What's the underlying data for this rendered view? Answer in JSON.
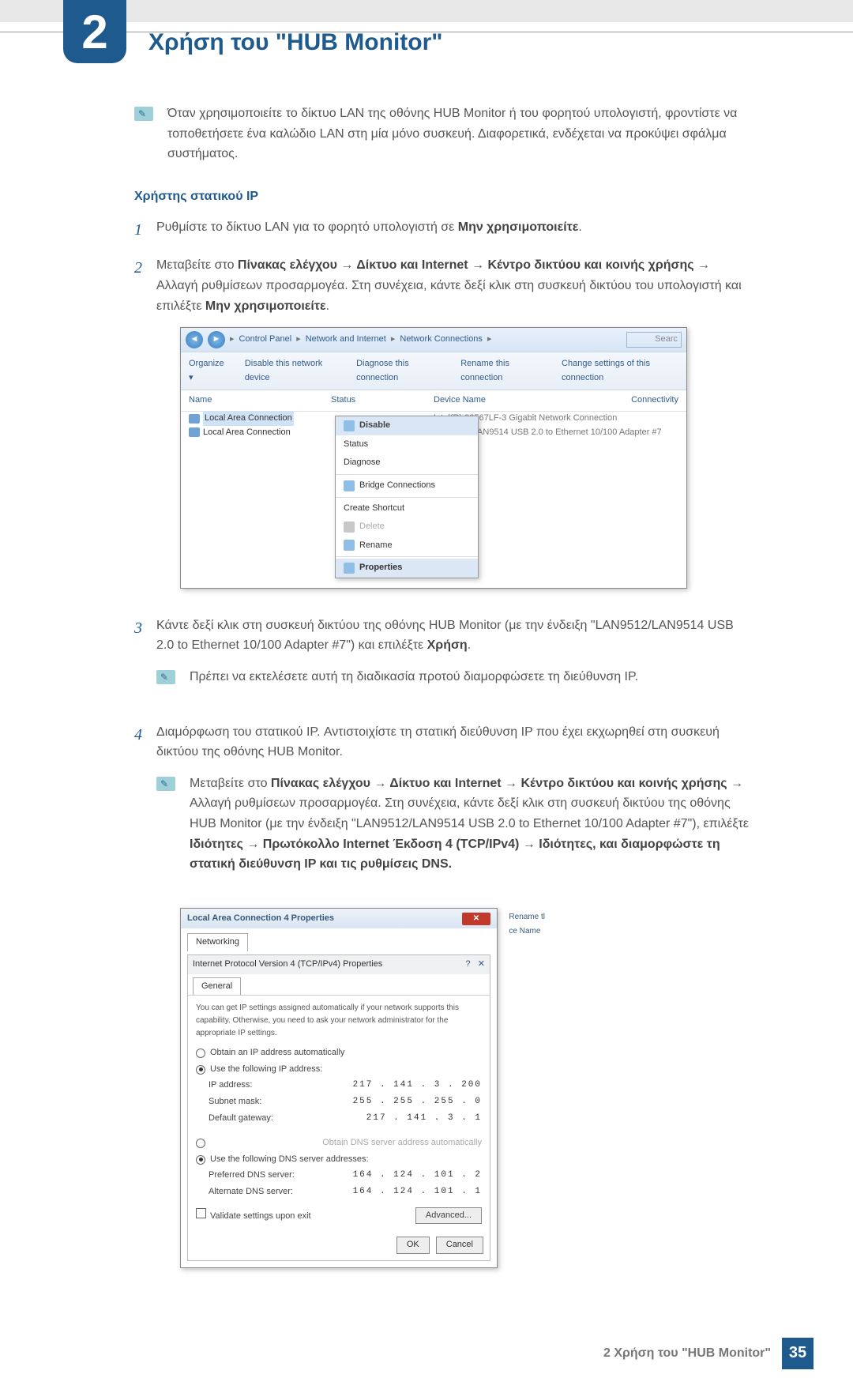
{
  "chapter": {
    "number": "2",
    "title": "Χρήση του \"HUB Monitor\""
  },
  "top_note": "Όταν χρησιμοποιείτε το δίκτυο LAN της οθόνης HUB Monitor ή του φορητού υπολογιστή, φροντίστε να τοποθετήσετε ένα καλώδιο LAN στη μία μόνο συσκευή. Διαφορετικά, ενδέχεται να προκύψει σφάλμα συστήματος.",
  "section_heading": "Χρήστης στατικού IP",
  "steps": {
    "1": {
      "pre": "Ρυθμίστε το δίκτυο LAN για το φορητό υπολογιστή σε ",
      "bold": "Μην χρησιμοποιείτε",
      "post": "."
    },
    "2": {
      "p1a": "Μεταβείτε στο ",
      "p1b": "Πίνακας ελέγχου",
      "arrow": " → ",
      "p1c": "Δίκτυο και Internet",
      "p1d": "Κέντρο δικτύου και κοινής χρήσης",
      "p2a": " Αλλαγή ρυθμίσεων προσαρμογέα. Στη συνέχεια, κάντε δεξί κλικ στη συσκευή δικτύου του υπολογιστή και επιλέξτε ",
      "p2b": "Μην χρησιμοποιείτε",
      "p2c": "."
    },
    "3": {
      "p1": "Κάντε δεξί κλικ στη συσκευή δικτύου της οθόνης HUB Monitor (με την ένδειξη \"LAN9512/LAN9514 USB 2.0 to Ethernet 10/100 Adapter #7\") και επιλέξτε ",
      "bold": "Χρήση",
      "post": ".",
      "note": "Πρέπει να εκτελέσετε αυτή τη διαδικασία προτού διαμορφώσετε τη διεύθυνση IP."
    },
    "4": {
      "head": "Διαμόρφωση του στατικού IP. Αντιστοιχίστε τη στατική διεύθυνση IP που έχει εκχωρηθεί στη συσκευή δικτύου της οθόνης HUB Monitor.",
      "note_a": "Μεταβείτε στο ",
      "note_b": "Πίνακας ελέγχου",
      "arrow": " → ",
      "note_c": "Δίκτυο και Internet",
      "note_d": "Κέντρο δικτύου και κοινής χρήσης",
      "note_e": " Αλλαγή ρυθμίσεων προσαρμογέα. Στη συνέχεια, κάντε δεξί κλικ στη συσκευή δικτύου της οθόνης HUB Monitor (με την ένδειξη \"LAN9512/LAN9514 USB 2.0 to Ethernet 10/100 Adapter #7\"), επιλέξτε ",
      "note_f": "Ιδιότητες",
      "note_g": "Πρωτόκολλο Internet Έκδοση 4 (TCP/IPv4)",
      "note_h": "Ιδιότητες, και διαμορφώστε τη στατική διεύθυνση IP και τις ρυθμίσεις DNS."
    }
  },
  "shot1": {
    "crumb_a": "Control Panel",
    "crumb_b": "Network and Internet",
    "crumb_c": "Network Connections",
    "search_ph": "Searc",
    "toolbar": {
      "organize": "Organize ▾",
      "disable": "Disable this network device",
      "diagnose": "Diagnose this connection",
      "rename": "Rename this connection",
      "change": "Change settings of this connection"
    },
    "cols": {
      "name": "Name",
      "status": "Status",
      "device": "Device Name",
      "conn": "Connectivity"
    },
    "rows": {
      "r1a": "Local Area Connection",
      "r1c": "Intel(R) 82567LF-3 Gigabit Network Connection",
      "r2a": "Local Area Connection",
      "r2c": "LAN9512/LAN9514 USB 2.0 to Ethernet 10/100 Adapter #7"
    },
    "ctx": {
      "disable": "Disable",
      "status": "Status",
      "diagnose": "Diagnose",
      "bridge": "Bridge Connections",
      "shortcut": "Create Shortcut",
      "delete": "Delete",
      "rename": "Rename",
      "properties": "Properties"
    }
  },
  "shot2": {
    "outer_title": "Local Area Connection 4 Properties",
    "tab_networking": "Networking",
    "side_rename": "Rename tl",
    "side_cename": "ce Name",
    "inner_title": "Internet Protocol Version 4 (TCP/IPv4) Properties",
    "tab_general": "General",
    "desc": "You can get IP settings assigned automatically if your network supports this capability. Otherwise, you need to ask your network administrator for the appropriate IP settings.",
    "r_auto_ip": "Obtain an IP address automatically",
    "r_use_ip": "Use the following IP address:",
    "f_ip": "IP address:",
    "v_ip": "217 . 141 . 3 . 200",
    "f_mask": "Subnet mask:",
    "v_mask": "255 . 255 . 255 . 0",
    "f_gw": "Default gateway:",
    "v_gw": "217 . 141 . 3 . 1",
    "r_auto_dns": "Obtain DNS server address automatically",
    "r_use_dns": "Use the following DNS server addresses:",
    "f_pdns": "Preferred DNS server:",
    "v_pdns": "164 . 124 . 101 . 2",
    "f_adns": "Alternate DNS server:",
    "v_adns": "164 . 124 . 101 . 1",
    "chk_validate": "Validate settings upon exit",
    "btn_adv": "Advanced...",
    "btn_ok": "OK",
    "btn_cancel": "Cancel"
  },
  "footer": {
    "text": "2 Χρήση του \"HUB Monitor\"",
    "page": "35"
  }
}
